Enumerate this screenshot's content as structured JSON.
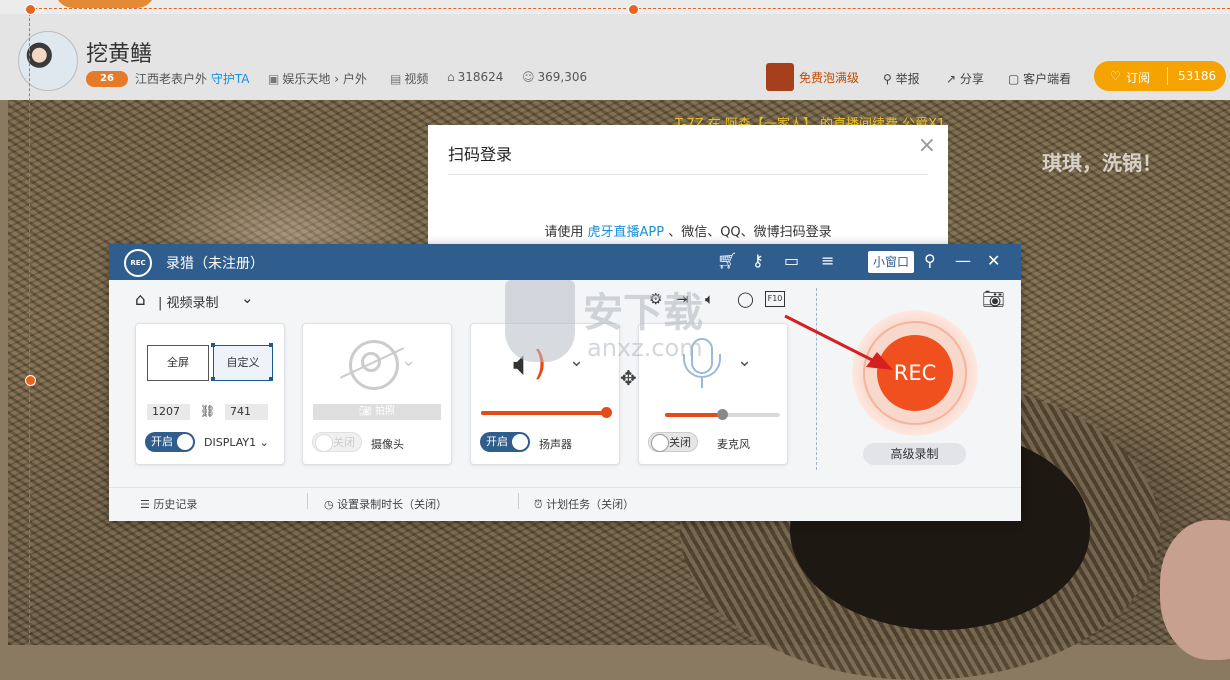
{
  "header": {
    "streamer_name": "挖黄鳝",
    "level": "26",
    "origin": "江西老表户外",
    "guard_link": "守护TA",
    "category_path": "娱乐天地",
    "category_sep": "›",
    "category_sub": "户外",
    "video_label": "视频",
    "room_id": "318624",
    "viewers": "369,306",
    "gift_label": "免费泡满级",
    "report_label": "举报",
    "share_label": "分享",
    "client_label": "客户端看",
    "subscribe_label": "订阅",
    "subscribe_count": "53186"
  },
  "danmaku": {
    "line1": "T-7Z 在 阿森【一家人】 的直播间续费 公爵X1",
    "line2": "琪琪，洗锅！"
  },
  "qr_dialog": {
    "title": "扫码登录",
    "text_prefix": "请使用",
    "app_link": "虎牙直播APP",
    "text_suffix": "、微信、QQ、微博扫码登录",
    "close": "×"
  },
  "recorder": {
    "logo": "REC",
    "title": "录猎（未注册）",
    "mini_window": "小窗口",
    "mode": "视频录制",
    "screen": {
      "full": "全屏",
      "custom": "自定义",
      "width": "1207",
      "height": "741",
      "toggle": "开启",
      "display": "DISPLAY1"
    },
    "camera": {
      "snapshot": "拍照",
      "toggle": "关闭",
      "label": "摄像头"
    },
    "speaker": {
      "toggle": "开启",
      "label": "扬声器",
      "volume": 1.0
    },
    "mic": {
      "toggle": "关闭",
      "label": "麦克风",
      "volume": 0.5
    },
    "rec_button": "REC",
    "advanced": "高级录制",
    "footer": {
      "history": "历史记录",
      "duration": "设置录制时长（关闭）",
      "schedule": "计划任务（关闭）"
    }
  },
  "watermark": {
    "cn": "安下载",
    "en": "anxz.com"
  },
  "colors": {
    "accent_blue": "#2f5d8e",
    "rec_orange": "#f0501e",
    "selection": "#e8641e",
    "link_blue": "#1b8fd8"
  }
}
